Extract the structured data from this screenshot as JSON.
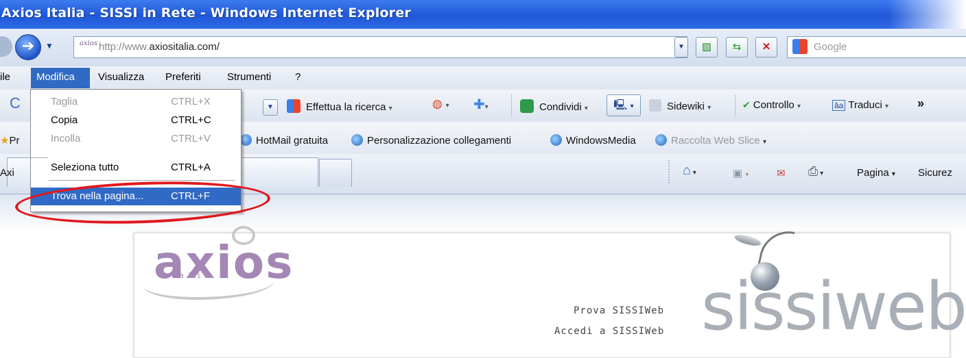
{
  "window": {
    "title": "Axios Italia - SISSI in Rete - Windows Internet Explorer"
  },
  "address": {
    "url_prefix": "http://www.",
    "url_main": "axiositalia.com/",
    "search_placeholder": "Google"
  },
  "menubar": [
    {
      "label": "ile"
    },
    {
      "label": "Modifica"
    },
    {
      "label": "Visualizza"
    },
    {
      "label": "Preferiti"
    },
    {
      "label": "Strumenti"
    },
    {
      "label": "?"
    }
  ],
  "toolbar": {
    "search_label": "Effettua la ricerca",
    "condividi": "Condividi",
    "sidewiki": "Sidewiki",
    "controllo": "Controllo",
    "traduci": "Traduci",
    "more": "»"
  },
  "favorites": {
    "partial": "Pr",
    "items": [
      {
        "label": "HotMail gratuita"
      },
      {
        "label": "Personalizzazione collegamenti"
      },
      {
        "label": "WindowsMedia"
      },
      {
        "label": "Raccolta Web Slice"
      }
    ]
  },
  "tabs": {
    "current_partial": "Axi"
  },
  "commandbar": {
    "pagina": "Pagina",
    "sicurezza_partial": "Sicurez"
  },
  "edit_menu": [
    {
      "label": "Taglia",
      "shortcut": "CTRL+X",
      "enabled": false
    },
    {
      "label": "Copia",
      "shortcut": "CTRL+C",
      "enabled": true
    },
    {
      "label": "Incolla",
      "shortcut": "CTRL+V",
      "enabled": false
    },
    {
      "label": "Seleziona tutto",
      "shortcut": "CTRL+A",
      "enabled": true
    },
    {
      "label": "Trova nella pagina...",
      "shortcut": "CTRL+F",
      "enabled": true,
      "highlighted": true
    }
  ],
  "page": {
    "logo_text": "axios",
    "logo_sub": "italia",
    "link_prova": "Prova SISSIWeb",
    "link_accedi": "Accedi a SISSIWeb",
    "brand": "sissiweb"
  },
  "colors": {
    "title_blue": "#2a62e0",
    "menu_highlight": "#316ac5",
    "annotation_red": "#e1181d",
    "axios_purple": "#a487b4"
  }
}
